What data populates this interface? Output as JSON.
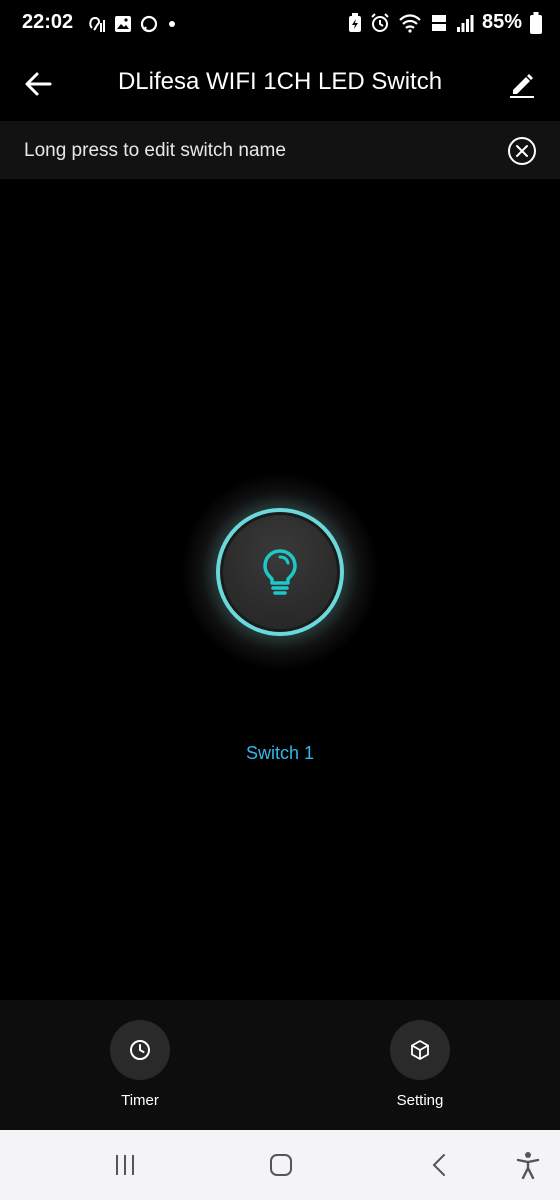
{
  "status_bar": {
    "time": "22:02",
    "battery_percent": "85%"
  },
  "app_bar": {
    "title": "DLifesa WIFI 1CH LED Switch"
  },
  "hint": {
    "text": "Long press to edit switch name"
  },
  "switch": {
    "label": "Switch 1",
    "state": "on",
    "accent_color": "#6ad9dc",
    "icon": "lightbulb-icon"
  },
  "bottom_bar": {
    "timer_label": "Timer",
    "setting_label": "Setting"
  },
  "colors": {
    "background": "#000000",
    "switch_label": "#33b8e8",
    "nav_bar": "#f4f4f6"
  }
}
